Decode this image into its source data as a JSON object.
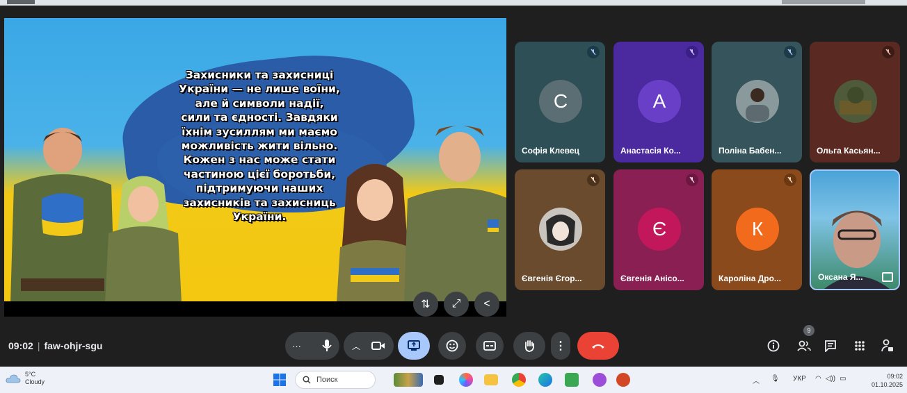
{
  "slide": {
    "lines": [
      "Захисники та захисниці",
      "України — не лише воїни,",
      "але й символи надії,",
      "сили та єдності. Завдяки",
      "їхнім зусиллям ми маємо",
      "можливість жити вільно.",
      "Кожен з нас може стати",
      "частиною цієї боротьби,",
      "підтримуючи наших",
      "захисників та захисниць",
      "України."
    ]
  },
  "participants": [
    {
      "name": "Софія Клевец",
      "initial": "С",
      "bg": "#2f4f57",
      "avatar_color": "#5b6e74"
    },
    {
      "name": "Анастасія Ко...",
      "initial": "А",
      "bg": "#4a2a9e",
      "avatar_color": "#6a3fc8"
    },
    {
      "name": "Поліна Бабен...",
      "initial": "",
      "bg": "#35545b",
      "avatar_color": "#8a9a9c"
    },
    {
      "name": "Ольга Касьян...",
      "initial": "",
      "bg": "#5a2a22",
      "avatar_color": "#4f5a3a"
    },
    {
      "name": "Євгенія Єгор...",
      "initial": "",
      "bg": "#6a4b2e",
      "avatar_color": "#c9c4bd"
    },
    {
      "name": "Євгенія Анісо...",
      "initial": "Є",
      "bg": "#8a1f53",
      "avatar_color": "#c2185b"
    },
    {
      "name": "Кароліна Дро...",
      "initial": "К",
      "bg": "#8a4a1c",
      "avatar_color": "#f26b1d"
    },
    {
      "name": "Оксана Я...",
      "initial": "",
      "bg": "#3d8fbf",
      "avatar_color": "#b58a78"
    }
  ],
  "meeting": {
    "time": "09:02",
    "code": "faw-ohjr-sgu",
    "people_count": "9"
  },
  "taskbar": {
    "temp": "5°C",
    "weather": "Cloudy",
    "search_placeholder": "Поиск",
    "language": "УКР",
    "clock_time": "09:02",
    "clock_date": "01.10.2025"
  },
  "colors": {
    "hangup": "#ea4335",
    "present_active": "#a8c7fa",
    "bar_bg": "#202124"
  }
}
